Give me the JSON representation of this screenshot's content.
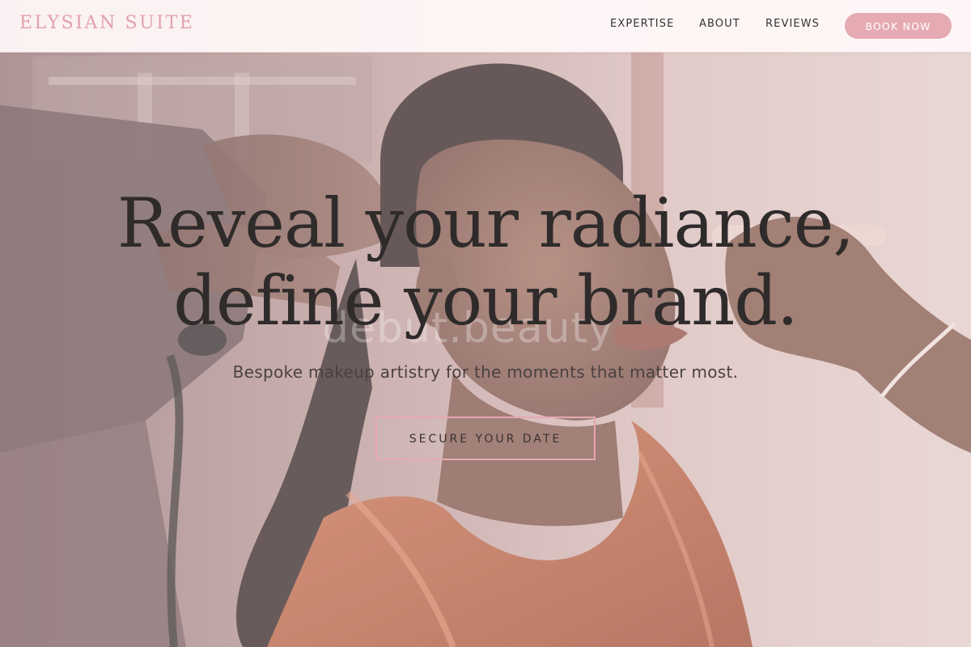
{
  "header": {
    "brand": "ELYSIAN SUITE",
    "nav": {
      "expertise": "EXPERTISE",
      "about": "ABOUT",
      "reviews": "REVIEWS"
    },
    "book_button": "BOOK NOW"
  },
  "hero": {
    "title_line1": "Reveal your radiance,",
    "title_line2": "define your brand.",
    "subtitle": "Bespoke makeup artistry for the moments that matter most.",
    "cta": "SECURE YOUR DATE",
    "watermark": "debut.beauty"
  },
  "colors": {
    "accent_pink": "#e5aab2",
    "brand_text": "#e1a1ac",
    "heading_text": "#2f2b2b",
    "header_bg": "#fff8f8"
  },
  "image": {
    "hero_photo": "makeup-artist-applying-makeup-to-woman-in-orange-satin-robe"
  }
}
